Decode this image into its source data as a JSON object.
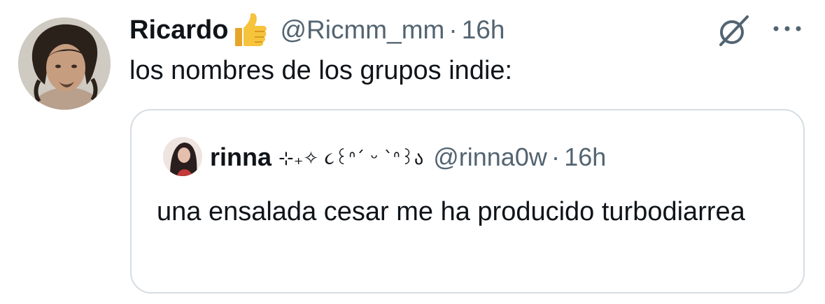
{
  "tweet": {
    "author": {
      "display_name": "Ricardo",
      "name_emoji": "thumbs-up-emoji",
      "handle": "@Ricmm_mm",
      "time": "16h"
    },
    "text": "los nombres de los grupos indie:",
    "icons": {
      "grok": "grok-icon",
      "more": "more-icon"
    }
  },
  "quote": {
    "author": {
      "display_name": "rinna",
      "name_decoration": "⊹₊✧ ૮꒰ᐢ´ ᵕ `ᐢ꒱ა",
      "handle": "@rinna0w",
      "time": "16h"
    },
    "text": "una ensalada cesar me ha producido turbodiarrea"
  },
  "separator": "·",
  "colors": {
    "text": "#0f1419",
    "secondary": "#536471",
    "border": "#d6dde2",
    "emoji": "#f6c33d"
  }
}
